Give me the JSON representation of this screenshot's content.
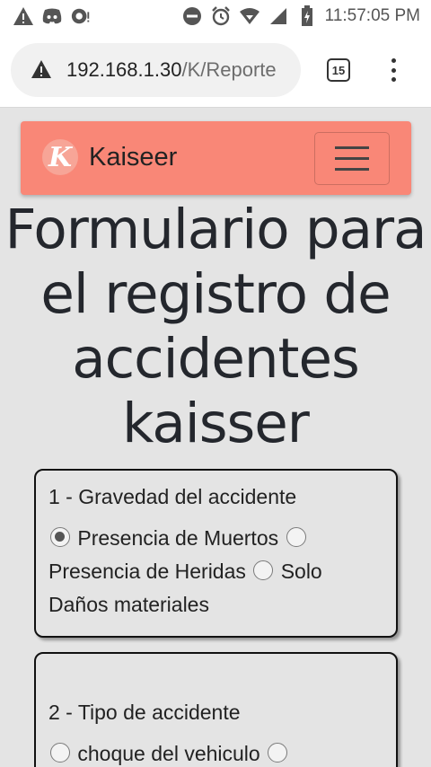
{
  "status_bar": {
    "time": "11:57:05 PM",
    "left_icons": [
      "warning-icon",
      "discord-icon",
      "sync-icon"
    ],
    "right_icons": [
      "do-not-disturb-icon",
      "alarm-icon",
      "wifi-icon",
      "signal-icon",
      "battery-icon"
    ]
  },
  "browser": {
    "url_host": "192.168.1.30",
    "url_path": "/K/Reporte",
    "tab_count": "15"
  },
  "navbar": {
    "logo_letter": "K",
    "brand": "Kaiseer",
    "color": "#f98777"
  },
  "page": {
    "title": "Formulario para el registro de accidentes kaisser"
  },
  "questions": [
    {
      "label": "1 - Gravedad del accidente",
      "options": [
        {
          "label": "Presencia de Muertos",
          "checked": true
        },
        {
          "label": "Presencia de Heridas",
          "checked": false
        },
        {
          "label": "Solo Daños materiales",
          "checked": false
        }
      ]
    },
    {
      "label": "2 - Tipo de accidente",
      "options": [
        {
          "label": "choque del vehiculo",
          "checked": false
        }
      ]
    }
  ]
}
